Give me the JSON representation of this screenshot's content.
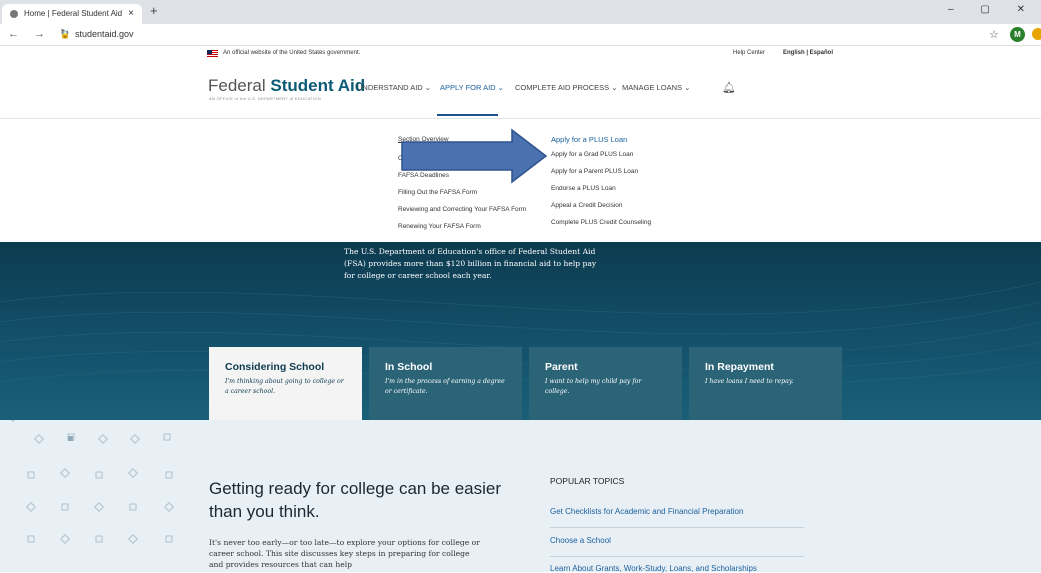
{
  "browser": {
    "tab_title": "Home | Federal Student Aid",
    "tab_close": "×",
    "new_tab": "+",
    "url": "studentaid.gov",
    "profile_initial": "M"
  },
  "banner": {
    "official": "An official website of the United States government.",
    "help": "Help Center",
    "language": "English | Español"
  },
  "header": {
    "logo_light": "Federal ",
    "logo_bold": "Student Aid",
    "logo_sub": "AN OFFICE of the U.S. DEPARTMENT of EDUCATION",
    "nav": [
      "UNDERSTAND AID",
      "APPLY FOR AID",
      "COMPLETE AID PROCESS",
      "MANAGE LOANS"
    ]
  },
  "menu": {
    "col1": [
      "Section Overview",
      "C",
      "FAFSA Deadlines",
      "Filling Out the FAFSA Form",
      "Reviewing and Correcting Your FAFSA Form",
      "Renewing Your FAFSA Form"
    ],
    "col2_heading": "Apply for a PLUS Loan",
    "col2": [
      "Apply for a Grad PLUS Loan",
      "Apply for a Parent PLUS Loan",
      "Endorse a PLUS Loan",
      "Appeal a Credit Decision",
      "Complete PLUS Credit Counseling"
    ]
  },
  "hero": {
    "text": "The U.S. Department of Education's office of Federal Student Aid (FSA) provides more than $120 billion in financial aid to help pay for college or career school each year.",
    "cards": [
      {
        "title": "Considering School",
        "desc": "I'm thinking about going to college or a career school."
      },
      {
        "title": "In School",
        "desc": "I'm in the process of earning a degree or certificate."
      },
      {
        "title": "Parent",
        "desc": "I want to help my child pay for college."
      },
      {
        "title": "In Repayment",
        "desc": "I have loans I need to repay."
      }
    ]
  },
  "main": {
    "heading": "Getting ready for college can be easier than you think.",
    "intro": "It's never too early—or too late—to explore your options for college or career school. This site discusses key steps in preparing for college and provides resources that can help",
    "popular_heading": "POPULAR TOPICS",
    "popular": [
      "Get Checklists for Academic and Financial Preparation",
      "Choose a School",
      "Learn About Grants, Work-Study, Loans, and Scholarships"
    ]
  },
  "colors": {
    "brand": "#0b5b76",
    "link": "#1a5f9e",
    "hero": "#13506a",
    "arrow": "#4a72b0"
  }
}
